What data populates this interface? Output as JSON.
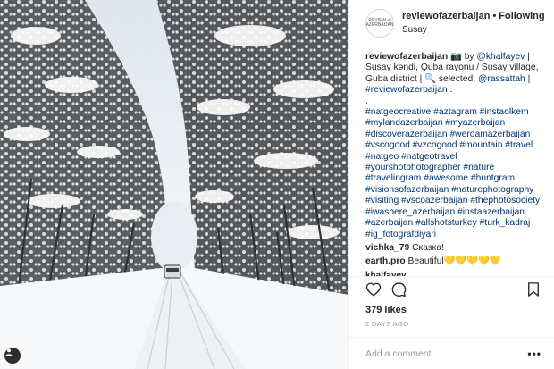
{
  "post": {
    "author": "reviewofazerbaijan",
    "separator": "•",
    "follow_status": "Following",
    "location": "Susay",
    "avatar_text": "REVIEW of AZERBAIJAN",
    "caption": {
      "author": "reviewofazerbaijan",
      "intro": "📷 by",
      "photographer": "@khalfayev",
      "place": "| Susay kəndi, Quba rayonu / Susay village, Guba district | 🔍 selected:",
      "selector": "@rassattah",
      "pipe": "|",
      "tag_line": "#reviewofazerbaijan",
      "tag_end": ".",
      "dot": ".",
      "hashtags": "#natgeocreative #aztagram #instaolkem #mylandazerbaijan #myazerbaijan #discoverazerbaijan #weroamazerbaijan #vscogood #vzcogood #mountain #travel #natgeo #natgeotravel #yourshotphotographer #nature #travelingram #awesome #huntgram #visionsofazerbaijan #naturephotography #visiting #vscoazerbaijan #thephotosociety #iwashere_azerbaijan #instaazerbaijan #azerbaijan #allshotsturkey #turk_kadraj #ig_fotografdiyari"
    },
    "comments": [
      {
        "user": "vichka_79",
        "text": "Сказка!"
      },
      {
        "user": "earth.pro",
        "text": "Beautiful💛💛💛💛💛"
      }
    ],
    "partial_comment_user": "khalfayev",
    "likes": "379 likes",
    "date": "2 DAYS AGO",
    "add_comment_placeholder": "Add a comment...",
    "more_options": "•••"
  },
  "colors": {
    "link": "#003569",
    "text": "#262626",
    "muted": "#999999"
  }
}
